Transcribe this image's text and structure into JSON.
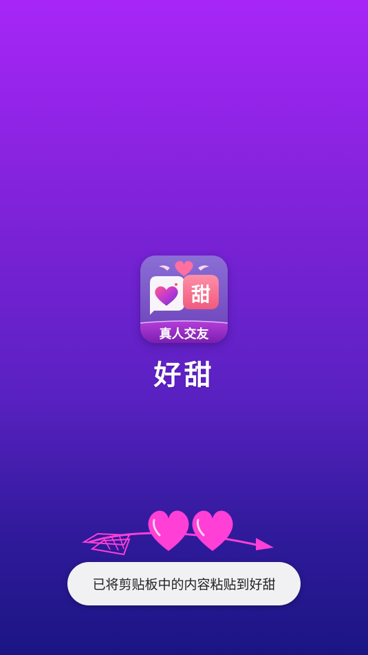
{
  "app": {
    "name": "好甜",
    "icon": {
      "name": "app-logo-icon",
      "badge_text": "真人交友",
      "bubble_text": "甜"
    }
  },
  "decoration": {
    "icon": "hearts-arrow-icon",
    "color": "#ff3fd6"
  },
  "toast": {
    "message": "已将剪贴板中的内容粘贴到好甜"
  },
  "colors": {
    "background_top": "#a726f7",
    "background_bottom": "#1b1584",
    "toast_background": "#f1f1f3",
    "accent_pink": "#ff3fd6"
  }
}
